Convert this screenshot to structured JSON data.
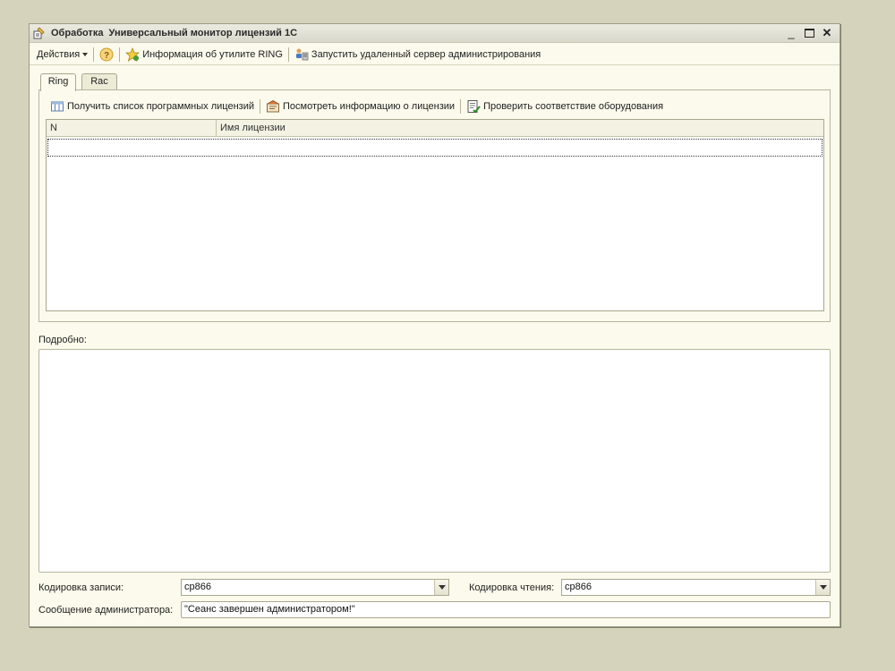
{
  "window": {
    "title": "Обработка  Универсальный монитор лицензий 1С",
    "minimize_glyph": "_",
    "close_glyph": "✕"
  },
  "toolbar": {
    "actions_label": "Действия",
    "help_glyph": "?",
    "ring_info_label": "Информация об утилите RING",
    "launch_server_label": "Запустить удаленный сервер администрирования"
  },
  "tabs": [
    {
      "label": "Ring",
      "active": true
    },
    {
      "label": "Rac",
      "active": false
    }
  ],
  "ring_panel": {
    "get_list_label": "Получить список программных лицензий",
    "view_info_label": "Посмотреть информацию о лицензии",
    "check_hw_label": "Проверить соответствие оборудования",
    "columns": [
      "N",
      "Имя лицензии"
    ],
    "rows": []
  },
  "details": {
    "label": "Подробно:",
    "value": ""
  },
  "encoding": {
    "write_label": "Кодировка записи:",
    "write_value": "cp866",
    "read_label": "Кодировка чтения:",
    "read_value": "cp866"
  },
  "admin_message": {
    "label": "Сообщение администратора:",
    "value": "\"Сеанс завершен администратором!\""
  },
  "icons": {
    "title": "processing-icon",
    "help": "help-icon",
    "ring_info": "star-info-icon",
    "launch_server": "server-users-icon",
    "get_list": "list-grid-icon",
    "view_info": "license-view-icon",
    "check_hw": "check-document-icon"
  },
  "colors": {
    "background": "#d6d3bd",
    "window": "#fbfaec",
    "border": "#a9a790"
  }
}
